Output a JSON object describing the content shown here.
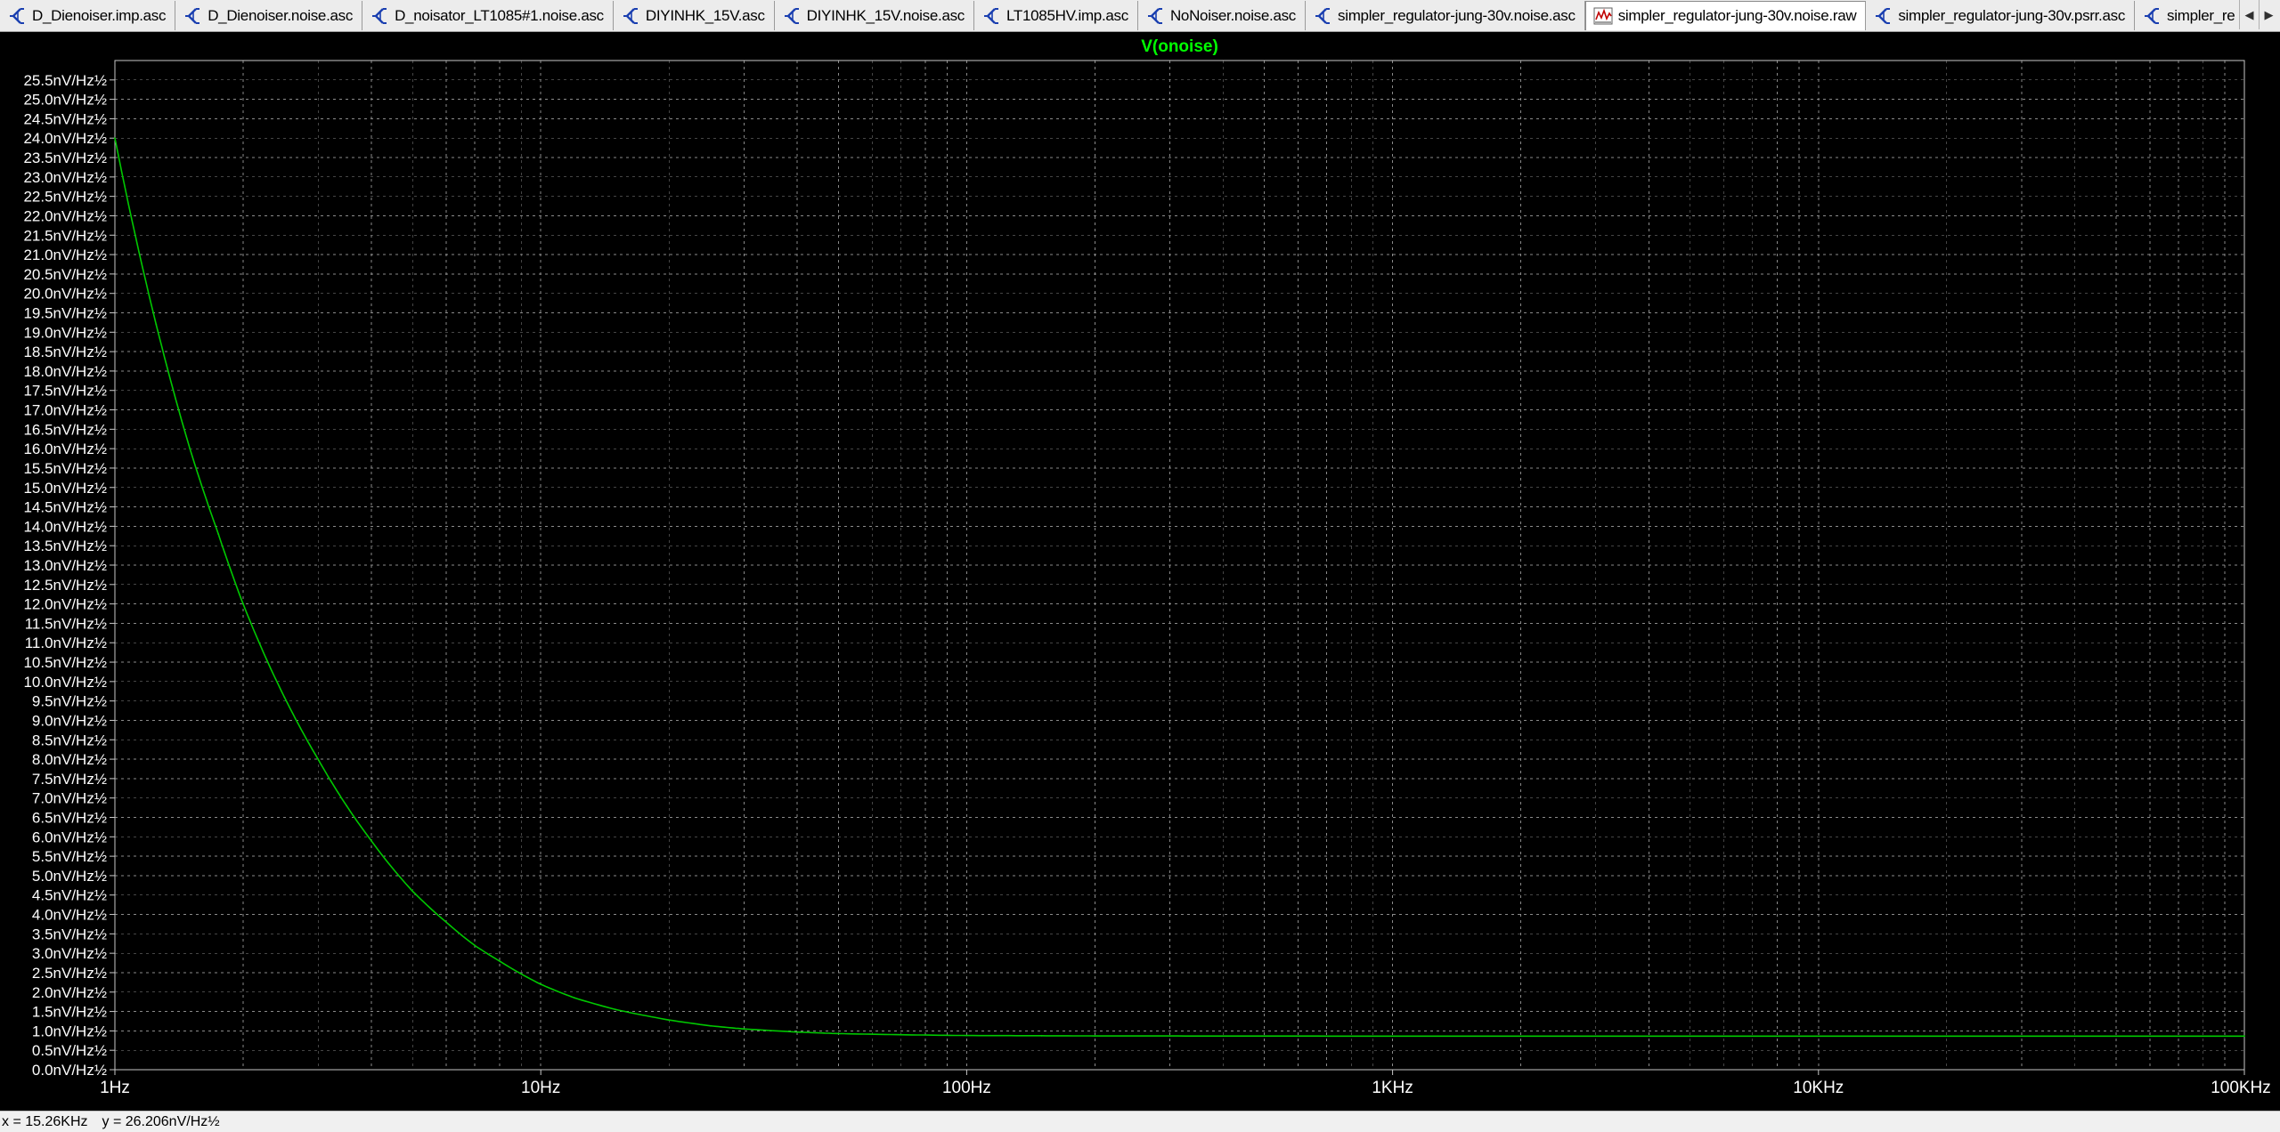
{
  "tabs": [
    {
      "label": "D_Dienoiser.imp.asc",
      "icon": "schematic-icon",
      "active": false
    },
    {
      "label": "D_Dienoiser.noise.asc",
      "icon": "schematic-icon",
      "active": false
    },
    {
      "label": "D_noisator_LT1085#1.noise.asc",
      "icon": "schematic-icon",
      "active": false
    },
    {
      "label": "DIYINHK_15V.asc",
      "icon": "schematic-icon",
      "active": false
    },
    {
      "label": "DIYINHK_15V.noise.asc",
      "icon": "schematic-icon",
      "active": false
    },
    {
      "label": "LT1085HV.imp.asc",
      "icon": "schematic-icon",
      "active": false
    },
    {
      "label": "NoNoiser.noise.asc",
      "icon": "schematic-icon",
      "active": false
    },
    {
      "label": "simpler_regulator-jung-30v.noise.asc",
      "icon": "schematic-icon",
      "active": false
    },
    {
      "label": "simpler_regulator-jung-30v.noise.raw",
      "icon": "waveform-icon",
      "active": true
    },
    {
      "label": "simpler_regulator-jung-30v.psrr.asc",
      "icon": "schematic-icon",
      "active": false
    },
    {
      "label": "simpler_re",
      "icon": "schematic-icon",
      "active": false
    }
  ],
  "tab_scroll": {
    "left": "◀",
    "right": "▶"
  },
  "status": {
    "x_readout": "x = 15.26KHz",
    "y_readout": "y = 26.206nV/Hz½"
  },
  "colors": {
    "background": "#000000",
    "trace": "#00c800",
    "grid": "#8a8a8a",
    "axis_text": "#ffffff",
    "title_text": "#00ff00"
  },
  "chart_data": {
    "type": "line",
    "title": "V(onoise)",
    "x_scale": "log",
    "x_range": [
      1,
      100000
    ],
    "y_range": [
      0,
      26
    ],
    "grid": true,
    "x_ticks": [
      {
        "value": 1,
        "label": "1Hz"
      },
      {
        "value": 10,
        "label": "10Hz"
      },
      {
        "value": 100,
        "label": "100Hz"
      },
      {
        "value": 1000,
        "label": "1KHz"
      },
      {
        "value": 10000,
        "label": "10KHz"
      },
      {
        "value": 100000,
        "label": "100KHz"
      }
    ],
    "y_ticks": [
      {
        "value": 0.0,
        "label": "0.0nV/Hz½"
      },
      {
        "value": 0.5,
        "label": "0.5nV/Hz½"
      },
      {
        "value": 1.0,
        "label": "1.0nV/Hz½"
      },
      {
        "value": 1.5,
        "label": "1.5nV/Hz½"
      },
      {
        "value": 2.0,
        "label": "2.0nV/Hz½"
      },
      {
        "value": 2.5,
        "label": "2.5nV/Hz½"
      },
      {
        "value": 3.0,
        "label": "3.0nV/Hz½"
      },
      {
        "value": 3.5,
        "label": "3.5nV/Hz½"
      },
      {
        "value": 4.0,
        "label": "4.0nV/Hz½"
      },
      {
        "value": 4.5,
        "label": "4.5nV/Hz½"
      },
      {
        "value": 5.0,
        "label": "5.0nV/Hz½"
      },
      {
        "value": 5.5,
        "label": "5.5nV/Hz½"
      },
      {
        "value": 6.0,
        "label": "6.0nV/Hz½"
      },
      {
        "value": 6.5,
        "label": "6.5nV/Hz½"
      },
      {
        "value": 7.0,
        "label": "7.0nV/Hz½"
      },
      {
        "value": 7.5,
        "label": "7.5nV/Hz½"
      },
      {
        "value": 8.0,
        "label": "8.0nV/Hz½"
      },
      {
        "value": 8.5,
        "label": "8.5nV/Hz½"
      },
      {
        "value": 9.0,
        "label": "9.0nV/Hz½"
      },
      {
        "value": 9.5,
        "label": "9.5nV/Hz½"
      },
      {
        "value": 10.0,
        "label": "10.0nV/Hz½"
      },
      {
        "value": 10.5,
        "label": "10.5nV/Hz½"
      },
      {
        "value": 11.0,
        "label": "11.0nV/Hz½"
      },
      {
        "value": 11.5,
        "label": "11.5nV/Hz½"
      },
      {
        "value": 12.0,
        "label": "12.0nV/Hz½"
      },
      {
        "value": 12.5,
        "label": "12.5nV/Hz½"
      },
      {
        "value": 13.0,
        "label": "13.0nV/Hz½"
      },
      {
        "value": 13.5,
        "label": "13.5nV/Hz½"
      },
      {
        "value": 14.0,
        "label": "14.0nV/Hz½"
      },
      {
        "value": 14.5,
        "label": "14.5nV/Hz½"
      },
      {
        "value": 15.0,
        "label": "15.0nV/Hz½"
      },
      {
        "value": 15.5,
        "label": "15.5nV/Hz½"
      },
      {
        "value": 16.0,
        "label": "16.0nV/Hz½"
      },
      {
        "value": 16.5,
        "label": "16.5nV/Hz½"
      },
      {
        "value": 17.0,
        "label": "17.0nV/Hz½"
      },
      {
        "value": 17.5,
        "label": "17.5nV/Hz½"
      },
      {
        "value": 18.0,
        "label": "18.0nV/Hz½"
      },
      {
        "value": 18.5,
        "label": "18.5nV/Hz½"
      },
      {
        "value": 19.0,
        "label": "19.0nV/Hz½"
      },
      {
        "value": 19.5,
        "label": "19.5nV/Hz½"
      },
      {
        "value": 20.0,
        "label": "20.0nV/Hz½"
      },
      {
        "value": 20.5,
        "label": "20.5nV/Hz½"
      },
      {
        "value": 21.0,
        "label": "21.0nV/Hz½"
      },
      {
        "value": 21.5,
        "label": "21.5nV/Hz½"
      },
      {
        "value": 22.0,
        "label": "22.0nV/Hz½"
      },
      {
        "value": 22.5,
        "label": "22.5nV/Hz½"
      },
      {
        "value": 23.0,
        "label": "23.0nV/Hz½"
      },
      {
        "value": 23.5,
        "label": "23.5nV/Hz½"
      },
      {
        "value": 24.0,
        "label": "24.0nV/Hz½"
      },
      {
        "value": 24.5,
        "label": "24.5nV/Hz½"
      },
      {
        "value": 25.0,
        "label": "25.0nV/Hz½"
      },
      {
        "value": 25.5,
        "label": "25.5nV/Hz½"
      }
    ],
    "series": [
      {
        "name": "V(onoise)",
        "x": [
          1,
          1.25,
          1.5,
          1.75,
          2,
          2.5,
          3,
          3.5,
          4,
          5,
          6,
          7,
          8,
          10,
          12,
          15,
          20,
          25,
          30,
          40,
          50,
          70,
          100,
          150,
          200,
          300,
          500,
          1000,
          2000,
          5000,
          10000,
          20000,
          50000,
          100000
        ],
        "values": [
          24.0,
          19.2,
          16.0,
          13.8,
          12.0,
          9.6,
          8.0,
          6.8,
          5.9,
          4.6,
          3.8,
          3.2,
          2.8,
          2.2,
          1.85,
          1.55,
          1.28,
          1.13,
          1.05,
          0.97,
          0.93,
          0.9,
          0.88,
          0.875,
          0.87,
          0.868,
          0.866,
          0.865,
          0.865,
          0.865,
          0.865,
          0.865,
          0.865,
          0.865
        ]
      }
    ]
  }
}
